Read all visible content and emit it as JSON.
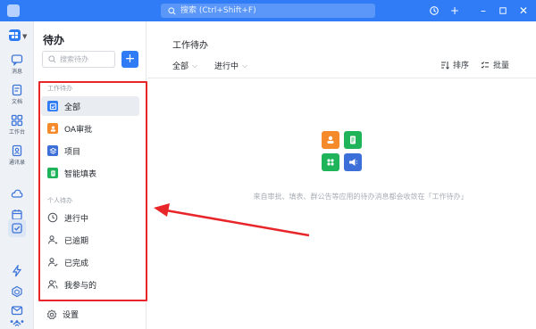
{
  "titlebar": {
    "search_placeholder": "搜索 (Ctrl+Shift+F)",
    "accent": "#2f7cf6"
  },
  "rail": {
    "items": [
      {
        "icon": "message-icon",
        "label": "消息"
      },
      {
        "icon": "document-icon",
        "label": "文档"
      },
      {
        "icon": "workbench-icon",
        "label": "工作台"
      },
      {
        "icon": "contacts-icon",
        "label": "通讯录"
      },
      {
        "icon": "cloud-icon",
        "label": ""
      },
      {
        "icon": "calendar-icon",
        "label": ""
      },
      {
        "icon": "todo-icon",
        "label": ""
      },
      {
        "icon": "lightning-icon",
        "label": ""
      },
      {
        "icon": "cube-icon",
        "label": ""
      },
      {
        "icon": "mail-icon",
        "label": ""
      },
      {
        "icon": "signal-icon",
        "label": ""
      },
      {
        "icon": "more-icon",
        "label": ""
      }
    ]
  },
  "panel": {
    "title": "待办",
    "search_placeholder": "搜索待办",
    "add_label": "+",
    "section_work": "工作待办",
    "section_personal": "个人待办",
    "work_items": [
      {
        "label": "全部",
        "icon": "all-icon",
        "color": "#2f7cf6"
      },
      {
        "label": "OA审批",
        "icon": "approval-icon",
        "color": "#f58a2b"
      },
      {
        "label": "项目",
        "icon": "project-icon",
        "color": "#3d6fd8"
      },
      {
        "label": "智能填表",
        "icon": "form-icon",
        "color": "#1fb35a"
      }
    ],
    "personal_items": [
      {
        "label": "进行中",
        "icon": "clock-icon"
      },
      {
        "label": "已逾期",
        "icon": "overdue-icon"
      },
      {
        "label": "已完成",
        "icon": "completed-icon"
      },
      {
        "label": "我参与的",
        "icon": "participants-icon"
      }
    ],
    "settings_label": "设置"
  },
  "main": {
    "title": "工作待办",
    "filter_all": "全部",
    "filter_status": "进行中",
    "sort_label": "排序",
    "batch_label": "批量",
    "empty_text": "来自审批、填表、群公告等应用的待办消息都会收敛在「工作待办」"
  }
}
